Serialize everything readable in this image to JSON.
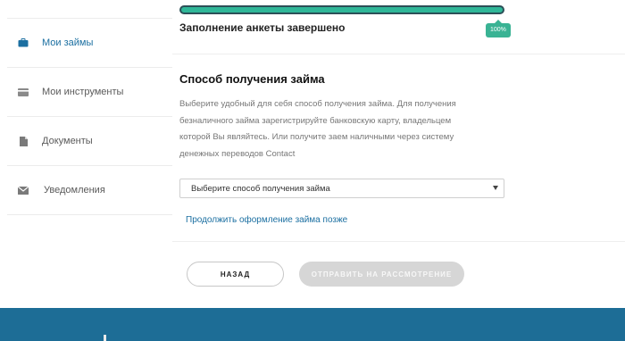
{
  "sidebar": {
    "items": [
      {
        "label": "Мои займы",
        "icon": "briefcase-icon",
        "active": true
      },
      {
        "label": "Мои инструменты",
        "icon": "card-icon",
        "active": false
      },
      {
        "label": "Документы",
        "icon": "document-icon",
        "active": false
      },
      {
        "label": "Уведомления",
        "icon": "envelope-icon",
        "active": false
      }
    ]
  },
  "progress": {
    "percent_value": 100,
    "badge": "100%",
    "label": "Заполнение анкеты завершено"
  },
  "loan_method": {
    "title": "Способ получения займа",
    "description": "Выберите удобный для себя способ получения займа. Для получения безналичного займа зарегистрируйте банковскую карту, владельцем которой Вы являйтесь. Или получите заем наличными через систему денежных переводов Contact",
    "select_value": "Выберите способ получения займа",
    "later_link": "Продолжить оформление займа позже"
  },
  "buttons": {
    "back": "Назад",
    "submit": "Отправить на рассмотрение"
  },
  "colors": {
    "accent": "#1b6fa1",
    "progress_fill": "#2fb798",
    "footer": "#1d6d96"
  }
}
